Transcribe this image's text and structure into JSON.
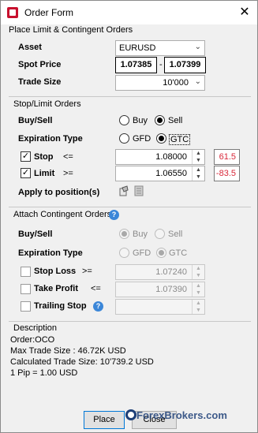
{
  "window": {
    "title": "Order Form",
    "close_glyph": "✕"
  },
  "place": {
    "heading": "Place Limit & Contingent Orders",
    "asset_label": "Asset",
    "asset_value": "EURUSD",
    "spot_label": "Spot Price",
    "spot_bid": "1.07385",
    "spot_sep": "-",
    "spot_ask": "1.07399",
    "trade_size_label": "Trade Size",
    "trade_size_value": "10'000"
  },
  "stop_limit": {
    "heading": "Stop/Limit Orders",
    "buysell_label": "Buy/Sell",
    "buy": "Buy",
    "sell": "Sell",
    "selected_side": "Sell",
    "expiration_label": "Expiration Type",
    "gfd": "GFD",
    "gtc": "GTC",
    "selected_expiration": "GTC",
    "stop_label": "Stop",
    "stop_op": "<=",
    "stop_checked": true,
    "stop_value": "1.08000",
    "stop_pips": "61.5",
    "limit_label": "Limit",
    "limit_op": ">=",
    "limit_checked": true,
    "limit_value": "1.06550",
    "limit_pips": "-83.5",
    "apply_label": "Apply to position(s)"
  },
  "contingent": {
    "heading": "Attach Contingent Orders",
    "buysell_label": "Buy/Sell",
    "buy": "Buy",
    "sell": "Sell",
    "selected_side": "Buy",
    "expiration_label": "Expiration Type",
    "gfd": "GFD",
    "gtc": "GTC",
    "selected_expiration": "GTC",
    "stop_loss_label": "Stop Loss",
    "stop_loss_op": ">=",
    "stop_loss_value": "1.07240",
    "take_profit_label": "Take Profit",
    "take_profit_op": "<=",
    "take_profit_value": "1.07390",
    "trailing_stop_label": "Trailing Stop"
  },
  "description": {
    "heading": "Description",
    "lines": [
      "Order:OCO",
      "Max Trade Size : 46.72K USD",
      "Calculated Trade Size: 10'739.2 USD",
      "1 Pip = 1.00 USD"
    ]
  },
  "buttons": {
    "place": "Place",
    "close": "Close"
  },
  "watermark": "ForexBrokers.com",
  "colors": {
    "pip_red": "#d9283a",
    "help_blue": "#3b86d8",
    "brand_red": "#c8102e"
  }
}
